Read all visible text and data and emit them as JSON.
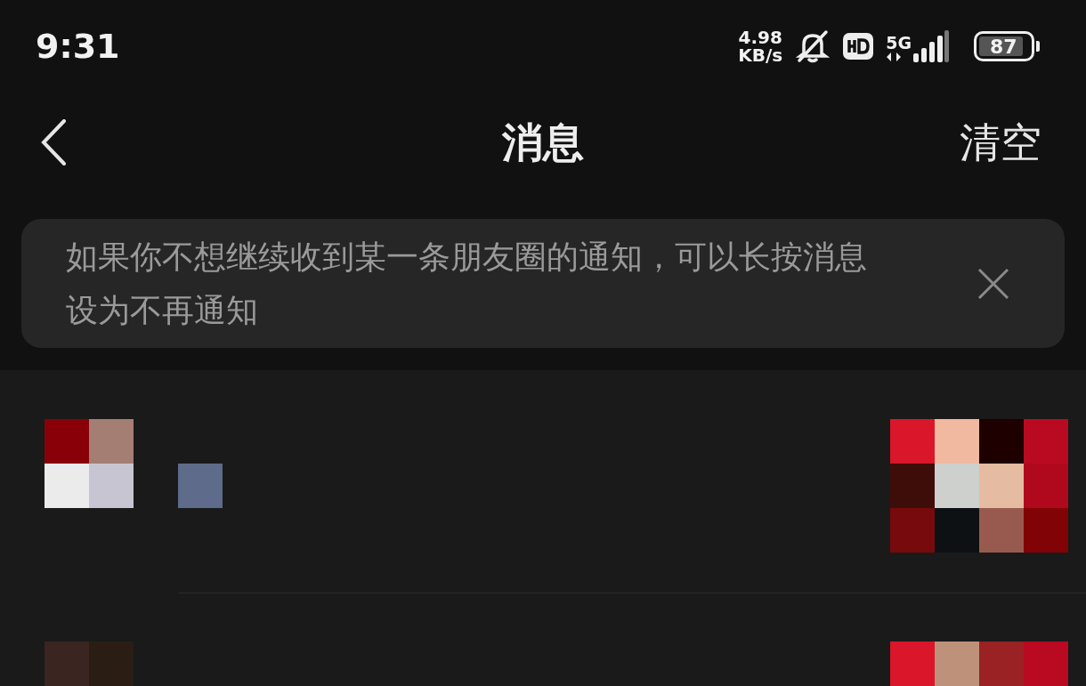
{
  "status_bar": {
    "time": "9:31",
    "speed_value": "4.98",
    "speed_unit": "KB/s",
    "network": "5G",
    "battery": "87"
  },
  "header": {
    "title": "消息",
    "clear_button": "清空"
  },
  "tip": {
    "text": "如果你不想继续收到某一条朋友圈的通知，可以长按消息设为不再通知"
  }
}
